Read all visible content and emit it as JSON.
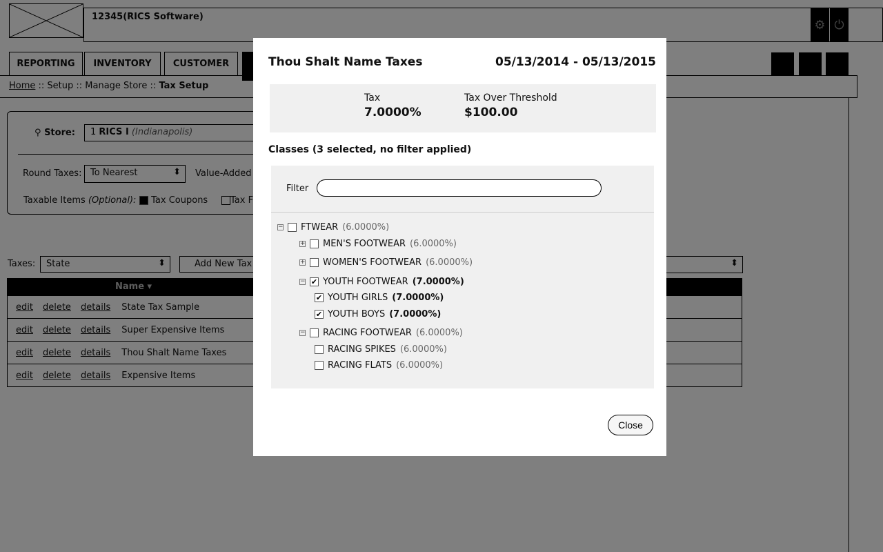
{
  "header": {
    "title": "12345(RICS Software)",
    "icons": [
      "gear-icon",
      "power-icon"
    ]
  },
  "tabs": [
    "REPORTING",
    "INVENTORY",
    "CUSTOMER"
  ],
  "breadcrumb": {
    "home": "Home",
    "sep1": " :: Setup :: Manage Store :: ",
    "current": "Tax Setup"
  },
  "store": {
    "label": "Store:",
    "num": "1",
    "name": "RICS I",
    "city": "(Indianapolis)"
  },
  "round": {
    "label": "Round Taxes:",
    "value": "To Nearest",
    "vat": "Value-Added T"
  },
  "taxable": {
    "label": "Taxable Items",
    "opt": "(Optional):",
    "coupons": "Tax Coupons",
    "other": "Tax F"
  },
  "taxes": {
    "label": "Taxes:",
    "value": "State",
    "add": "Add New Tax"
  },
  "table": {
    "name_header": "Name ▾",
    "actions": [
      "edit",
      "delete",
      "details"
    ],
    "rows": [
      "State Tax Sample",
      "Super Expensive Items",
      "Thou Shalt Name Taxes",
      "Expensive Items"
    ]
  },
  "modal": {
    "title": "Thou Shalt Name Taxes",
    "date_range": "05/13/2014 - 05/13/2015",
    "tax_label": "Tax",
    "tax_value": "7.0000%",
    "threshold_label": "Tax Over Threshold",
    "threshold_value": "$100.00",
    "classes_heading": "Classes (3 selected, no filter applied)",
    "filter_label": "Filter",
    "filter_value": "",
    "tree": [
      {
        "label": "FTWEAR",
        "pct": "(6.0000%)",
        "checked": false,
        "toggle": "⊟",
        "level": 0
      },
      {
        "label": "MEN'S FOOTWEAR",
        "pct": "(6.0000%)",
        "checked": false,
        "toggle": "⊞",
        "level": 1
      },
      {
        "label": "WOMEN'S FOOTWEAR",
        "pct": "(6.0000%)",
        "checked": false,
        "toggle": "⊞",
        "level": 1
      },
      {
        "label": "YOUTH FOOTWEAR",
        "pct": "(7.0000%)",
        "checked": true,
        "toggle": "⊟",
        "level": 1
      },
      {
        "label": "YOUTH GIRLS",
        "pct": "(7.0000%)",
        "checked": true,
        "toggle": "",
        "level": 2
      },
      {
        "label": "YOUTH BOYS",
        "pct": "(7.0000%)",
        "checked": true,
        "toggle": "",
        "level": 2
      },
      {
        "label": "RACING FOOTWEAR",
        "pct": "(6.0000%)",
        "checked": false,
        "toggle": "⊟",
        "level": 1
      },
      {
        "label": "RACING SPIKES",
        "pct": "(6.0000%)",
        "checked": false,
        "toggle": "",
        "level": 2
      },
      {
        "label": "RACING FLATS",
        "pct": "(6.0000%)",
        "checked": false,
        "toggle": "",
        "level": 2
      }
    ],
    "close": "Close"
  }
}
